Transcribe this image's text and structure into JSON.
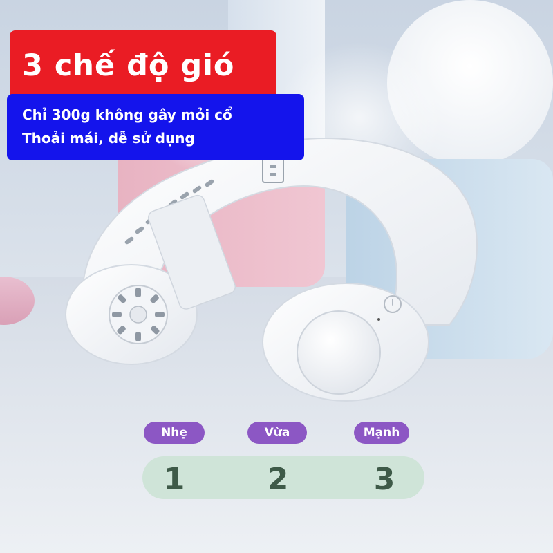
{
  "title": "3 chế độ gió",
  "subtitle": {
    "line1": "Chỉ 300g không gây mỏi cổ",
    "line2": "Thoải mái, dễ sử dụng"
  },
  "speeds": [
    {
      "label": "Nhẹ",
      "number": "1"
    },
    {
      "label": "Vừa",
      "number": "2"
    },
    {
      "label": "Mạnh",
      "number": "3"
    }
  ],
  "colors": {
    "title_banner": "#ea1c24",
    "subtitle_banner": "#1414ec",
    "speed_pill": "#8c57c4",
    "speed_bar": "#cfe4d8",
    "speed_number": "#3e5a48"
  },
  "product": "neck-fan-icon"
}
